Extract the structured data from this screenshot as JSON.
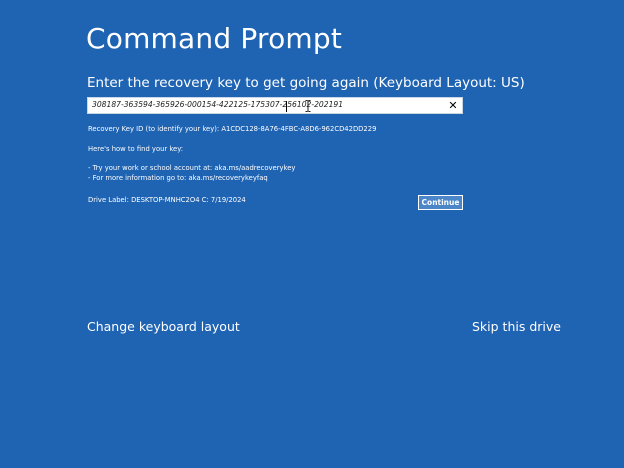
{
  "title": "Command Prompt",
  "subtitle": "Enter the recovery key to get going again (Keyboard Layout: US)",
  "recovery_input": {
    "value": "308187-363594-365926-000154-422125-175307-256102-202191",
    "clear_icon": "close-icon",
    "clear_glyph": "✕"
  },
  "info": {
    "key_id_line": "Recovery Key ID (to identify your key): A1CDC128-8A76-4FBC-A8D6-962CD42DD229",
    "how_to_heading": "Here's how to find your key:",
    "tip_1": "- Try your work or school account at: aka.ms/aadrecoverykey",
    "tip_2": "- For more information go to: aka.ms/recoverykeyfaq",
    "drive_label": "Drive Label: DESKTOP-MNHC2O4 C: 7/19/2024"
  },
  "buttons": {
    "continue": "Continue"
  },
  "footer": {
    "change_keyboard": "Change keyboard layout",
    "skip_drive": "Skip this drive"
  },
  "colors": {
    "background": "#1f63b3",
    "text": "#ffffff",
    "button_bg": "#4a86c8"
  }
}
